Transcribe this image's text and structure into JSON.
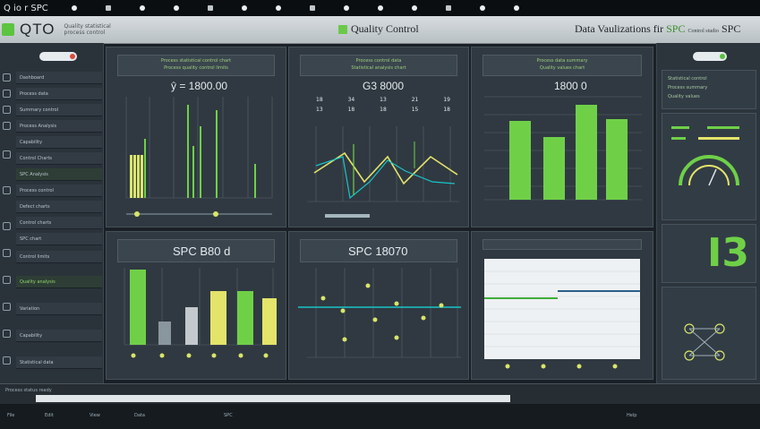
{
  "topbar": {
    "brand": "Q io r SPC"
  },
  "appbar": {
    "app_title": "QTO",
    "app_subtitle": "Quality statistical process control",
    "center_title": "Quality Control",
    "right_title": "Data Vaulizations",
    "right_fir": "fir",
    "right_spc": "SPC",
    "right_small": "Control studio",
    "right_spc2": "SPC"
  },
  "sidebar": {
    "items": [
      {
        "label": "Dashboard"
      },
      {
        "label": "Process data"
      },
      {
        "label": "Summary control"
      },
      {
        "label": "Process Analysis"
      },
      {
        "label": "Capability"
      },
      {
        "label": "Control Charts"
      },
      {
        "label": "SPC Analysis"
      },
      {
        "label": "Process control"
      },
      {
        "label": "Defect charts"
      },
      {
        "label": "Control charts"
      },
      {
        "label": "SPC chart"
      },
      {
        "label": "Control limits"
      },
      {
        "label": "Quality analysis"
      },
      {
        "label": "Variation"
      },
      {
        "label": "Capability"
      },
      {
        "label": "Statistical data"
      }
    ]
  },
  "panels": {
    "p1": {
      "hdr1": "Process statistical control chart",
      "hdr2": "Process quality control limits",
      "value": "ŷ = 1800.00"
    },
    "p2": {
      "hdr1": "Process control data",
      "hdr2": "Statistical analysis chart",
      "value": "G3 8000",
      "table": [
        [
          "18",
          "34",
          "13",
          "21",
          "19"
        ],
        [
          "13",
          "18",
          "18",
          "15",
          "18"
        ]
      ]
    },
    "p3": {
      "hdr1": "Process data summary",
      "hdr2": "Quality values chart",
      "value": "1800 0"
    },
    "p4": {
      "value": "SPC B80 d"
    },
    "p5": {
      "value": "SPC 18070"
    },
    "p6": {}
  },
  "rpanel": {
    "lines": [
      "Statistical control",
      "Process summary",
      "Quality values"
    ],
    "big_glyph": "I3"
  },
  "status": {
    "label": "Process status ready"
  },
  "bottombar": {
    "items": [
      "File",
      "Edit",
      "View",
      "Data",
      "SPC",
      "Help"
    ]
  },
  "colors": {
    "green": "#6fd048",
    "yellow": "#e4e36a",
    "cyan": "#19c4c9",
    "bg": "#1a2026"
  }
}
